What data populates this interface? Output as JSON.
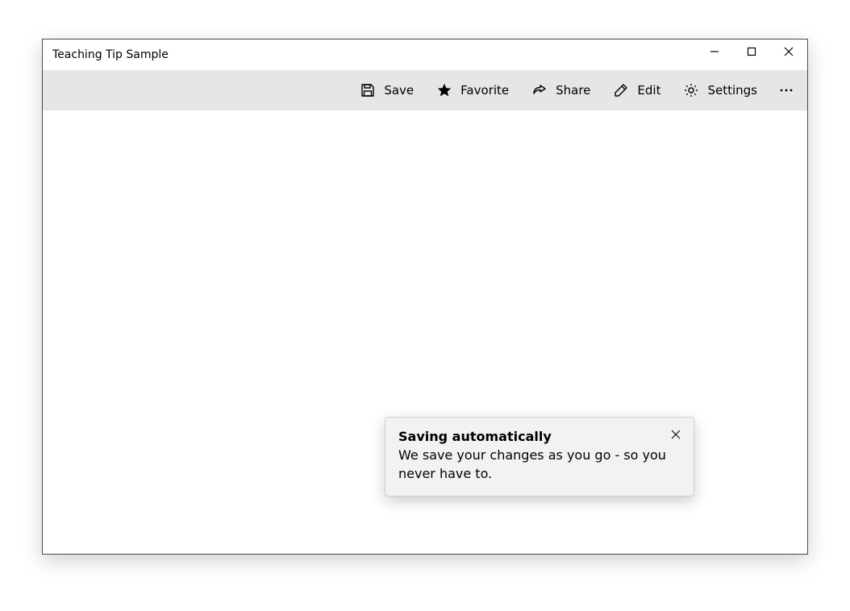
{
  "window": {
    "title": "Teaching Tip Sample"
  },
  "commands": {
    "save": "Save",
    "favorite": "Favorite",
    "share": "Share",
    "edit": "Edit",
    "settings": "Settings"
  },
  "teaching_tip": {
    "title": "Saving automatically",
    "body": "We save your changes as you go - so you never have to."
  }
}
